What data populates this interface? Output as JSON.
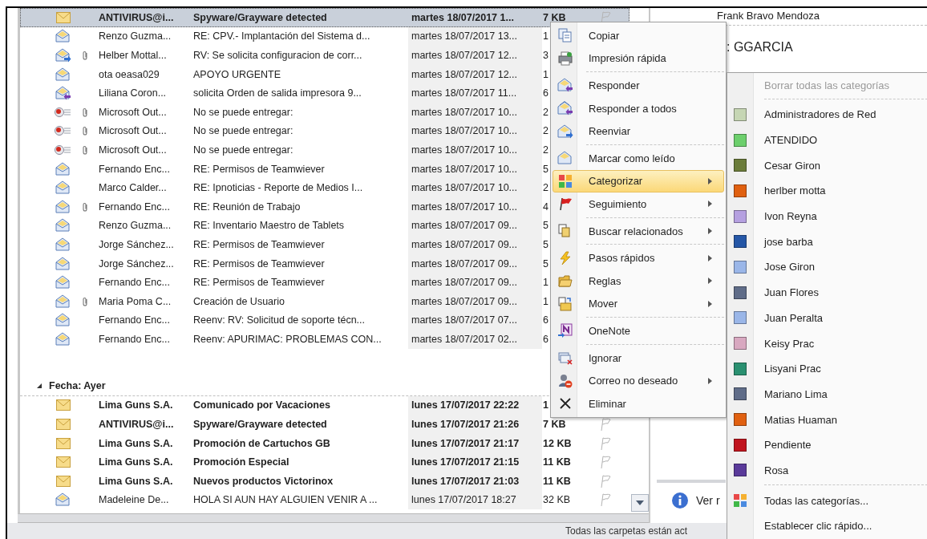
{
  "message_list": {
    "groups": [
      {
        "rows": [
          {
            "kind": "unread",
            "attachment": false,
            "unread": true,
            "selected": true,
            "flag": true,
            "from": "ANTIVIRUS@i...",
            "subject": "Spyware/Grayware detected",
            "received": "martes 18/07/2017 1...",
            "size": "7 KB"
          },
          {
            "kind": "read",
            "attachment": false,
            "unread": false,
            "selected": false,
            "from": "Renzo Guzma...",
            "subject": "RE: CPV.- Implantación del Sistema d...",
            "received": "martes 18/07/2017 13...",
            "size": "1"
          },
          {
            "kind": "forwarded",
            "attachment": true,
            "unread": false,
            "selected": false,
            "from": "Helber Mottal...",
            "subject": "RV: Se solicita configuracion de corr...",
            "received": "martes 18/07/2017 12...",
            "size": "3"
          },
          {
            "kind": "read",
            "attachment": false,
            "unread": false,
            "selected": false,
            "from": "ota oeasa029",
            "subject": "APOYO URGENTE",
            "received": "martes 18/07/2017 12...",
            "size": "1"
          },
          {
            "kind": "replied",
            "attachment": false,
            "unread": false,
            "selected": false,
            "from": "Liliana Coron...",
            "subject": "solicita Orden de salida impresora 9...",
            "received": "martes 18/07/2017 11...",
            "size": "6"
          },
          {
            "kind": "undeliverable",
            "attachment": true,
            "unread": false,
            "selected": false,
            "from": "Microsoft Out...",
            "subject": "No se puede entregar:",
            "received": "martes 18/07/2017 10...",
            "size": "2"
          },
          {
            "kind": "undeliverable",
            "attachment": true,
            "unread": false,
            "selected": false,
            "from": "Microsoft Out...",
            "subject": "No se puede entregar:",
            "received": "martes 18/07/2017 10...",
            "size": "2"
          },
          {
            "kind": "undeliverable",
            "attachment": true,
            "unread": false,
            "selected": false,
            "from": "Microsoft Out...",
            "subject": "No se puede entregar:",
            "received": "martes 18/07/2017 10...",
            "size": "2"
          },
          {
            "kind": "read",
            "attachment": false,
            "unread": false,
            "selected": false,
            "from": "Fernando Enc...",
            "subject": "RE: Permisos de Teamwiever",
            "received": "martes 18/07/2017 10...",
            "size": "5"
          },
          {
            "kind": "read",
            "attachment": false,
            "unread": false,
            "selected": false,
            "from": "Marco Calder...",
            "subject": "RE: Ipnoticias - Reporte de Medios I...",
            "received": "martes 18/07/2017 10...",
            "size": "2"
          },
          {
            "kind": "read",
            "attachment": true,
            "unread": false,
            "selected": false,
            "from": "Fernando Enc...",
            "subject": "RE: Reunión de Trabajo",
            "received": "martes 18/07/2017 10...",
            "size": "4"
          },
          {
            "kind": "read",
            "attachment": false,
            "unread": false,
            "selected": false,
            "from": "Renzo Guzma...",
            "subject": "RE: Inventario Maestro de Tablets",
            "received": "martes 18/07/2017 09...",
            "size": "5"
          },
          {
            "kind": "read",
            "attachment": false,
            "unread": false,
            "selected": false,
            "from": "Jorge Sánchez...",
            "subject": "RE: Permisos de Teamwiever",
            "received": "martes 18/07/2017 09...",
            "size": "5"
          },
          {
            "kind": "read",
            "attachment": false,
            "unread": false,
            "selected": false,
            "from": "Jorge Sánchez...",
            "subject": "RE: Permisos de Teamwiever",
            "received": "martes 18/07/2017 09...",
            "size": "5"
          },
          {
            "kind": "read",
            "attachment": false,
            "unread": false,
            "selected": false,
            "from": "Fernando Enc...",
            "subject": "RE: Permisos de Teamwiever",
            "received": "martes 18/07/2017 09...",
            "size": "1"
          },
          {
            "kind": "read",
            "attachment": true,
            "unread": false,
            "selected": false,
            "from": "Maria Poma C...",
            "subject": "Creación de Usuario",
            "received": "martes 18/07/2017 09...",
            "size": "1"
          },
          {
            "kind": "read",
            "attachment": false,
            "unread": false,
            "selected": false,
            "from": "Fernando Enc...",
            "subject": "Reenv: RV: Solicitud de soporte técn...",
            "received": "martes 18/07/2017 07...",
            "size": "6"
          },
          {
            "kind": "read",
            "attachment": false,
            "unread": false,
            "selected": false,
            "from": "Fernando Enc...",
            "subject": "Reenv: APURIMAC: PROBLEMAS CON...",
            "received": "martes 18/07/2017 02...",
            "size": "6"
          }
        ]
      },
      {
        "header": "Fecha: Ayer",
        "expanded": true,
        "rows": [
          {
            "kind": "unread",
            "attachment": false,
            "unread": true,
            "selected": false,
            "from": "Lima Guns S.A.",
            "subject": "Comunicado por Vacaciones",
            "received": "lunes 17/07/2017 22:22",
            "size": "1"
          },
          {
            "kind": "unread",
            "attachment": false,
            "unread": true,
            "selected": false,
            "flag": true,
            "from": "ANTIVIRUS@i...",
            "subject": "Spyware/Grayware detected",
            "received": "lunes 17/07/2017 21:26",
            "size": "7 KB"
          },
          {
            "kind": "unread",
            "attachment": false,
            "unread": true,
            "selected": false,
            "flag": true,
            "from": "Lima Guns S.A.",
            "subject": "Promoción de Cartuchos GB",
            "received": "lunes 17/07/2017 21:17",
            "size": "12 KB"
          },
          {
            "kind": "unread",
            "attachment": false,
            "unread": true,
            "selected": false,
            "flag": true,
            "from": "Lima Guns S.A.",
            "subject": "Promoción Especial",
            "received": "lunes 17/07/2017 21:15",
            "size": "11 KB"
          },
          {
            "kind": "unread",
            "attachment": false,
            "unread": true,
            "selected": false,
            "flag": true,
            "from": "Lima Guns S.A.",
            "subject": "Nuevos productos Victorinox",
            "received": "lunes 17/07/2017 21:03",
            "size": "11 KB"
          },
          {
            "kind": "read",
            "attachment": false,
            "unread": false,
            "selected": false,
            "flag": true,
            "from": "Madeleine De...",
            "subject": "HOLA SI AUN HAY ALGUIEN VENIR A ...",
            "received": "lunes 17/07/2017 18:27",
            "size": "32 KB"
          }
        ]
      }
    ]
  },
  "reading_pane": {
    "sender": "Frank Bravo Mendoza",
    "to": ": GGARCIA",
    "info_text": "Ver r"
  },
  "status_bar": "Todas las carpetas están act",
  "context_menu": {
    "items": [
      {
        "kind": "copy",
        "label": "Copiar",
        "submenu": false,
        "highlighted": false
      },
      {
        "kind": "print",
        "label": "Impresión rápida",
        "submenu": false,
        "highlighted": false
      },
      {
        "kind": "separator"
      },
      {
        "kind": "reply",
        "label": "Responder",
        "submenu": false,
        "highlighted": false
      },
      {
        "kind": "reply-all",
        "label": "Responder a todos",
        "submenu": false,
        "highlighted": false
      },
      {
        "kind": "forward",
        "label": "Reenviar",
        "submenu": false,
        "highlighted": false
      },
      {
        "kind": "separator"
      },
      {
        "kind": "mark-read",
        "label": "Marcar como leído",
        "submenu": false,
        "highlighted": false
      },
      {
        "kind": "categorize",
        "label": "Categorizar",
        "submenu": true,
        "highlighted": true
      },
      {
        "kind": "flag",
        "label": "Seguimiento",
        "submenu": true,
        "highlighted": false
      },
      {
        "kind": "separator"
      },
      {
        "kind": "find",
        "label": "Buscar relacionados",
        "submenu": true,
        "highlighted": false
      },
      {
        "kind": "separator"
      },
      {
        "kind": "lightning",
        "label": "Pasos rápidos",
        "submenu": true,
        "highlighted": false
      },
      {
        "kind": "rules",
        "label": "Reglas",
        "submenu": true,
        "highlighted": false
      },
      {
        "kind": "move",
        "label": "Mover",
        "submenu": true,
        "highlighted": false
      },
      {
        "kind": "separator"
      },
      {
        "kind": "onenote",
        "label": "OneNote",
        "submenu": false,
        "highlighted": false
      },
      {
        "kind": "separator"
      },
      {
        "kind": "ignore",
        "label": "Ignorar",
        "submenu": false,
        "highlighted": false
      },
      {
        "kind": "junk",
        "label": "Correo no deseado",
        "submenu": true,
        "highlighted": false
      },
      {
        "kind": "delete",
        "label": "Eliminar",
        "submenu": false,
        "highlighted": false
      }
    ]
  },
  "category_menu": {
    "clear": {
      "label": "Borrar todas las categorías",
      "disabled": true
    },
    "categories": [
      {
        "label": "Administradores de Red",
        "color": "#c6d6b4"
      },
      {
        "label": "ATENDIDO",
        "color": "#6ccf6c"
      },
      {
        "label": "Cesar Giron",
        "color": "#6b7c3a"
      },
      {
        "label": "herlber motta",
        "color": "#e06010"
      },
      {
        "label": "Ivon Reyna",
        "color": "#b5a0e0"
      },
      {
        "label": "jose barba",
        "color": "#2456a6"
      },
      {
        "label": "Jose Giron",
        "color": "#9ab6e8"
      },
      {
        "label": "Juan Flores",
        "color": "#5f6c88"
      },
      {
        "label": "Juan Peralta",
        "color": "#9ab6e8"
      },
      {
        "label": "Keisy Prac",
        "color": "#d8a8c0"
      },
      {
        "label": "Lisyani Prac",
        "color": "#2a9070"
      },
      {
        "label": "Mariano Lima",
        "color": "#5f6c88"
      },
      {
        "label": "Matias Huaman",
        "color": "#e06010"
      },
      {
        "label": "Pendiente",
        "color": "#c0141e"
      },
      {
        "label": "Rosa",
        "color": "#5a3a9a"
      }
    ],
    "all_label": "Todas las categorías...",
    "quick_click_label": "Establecer clic rápido..."
  }
}
